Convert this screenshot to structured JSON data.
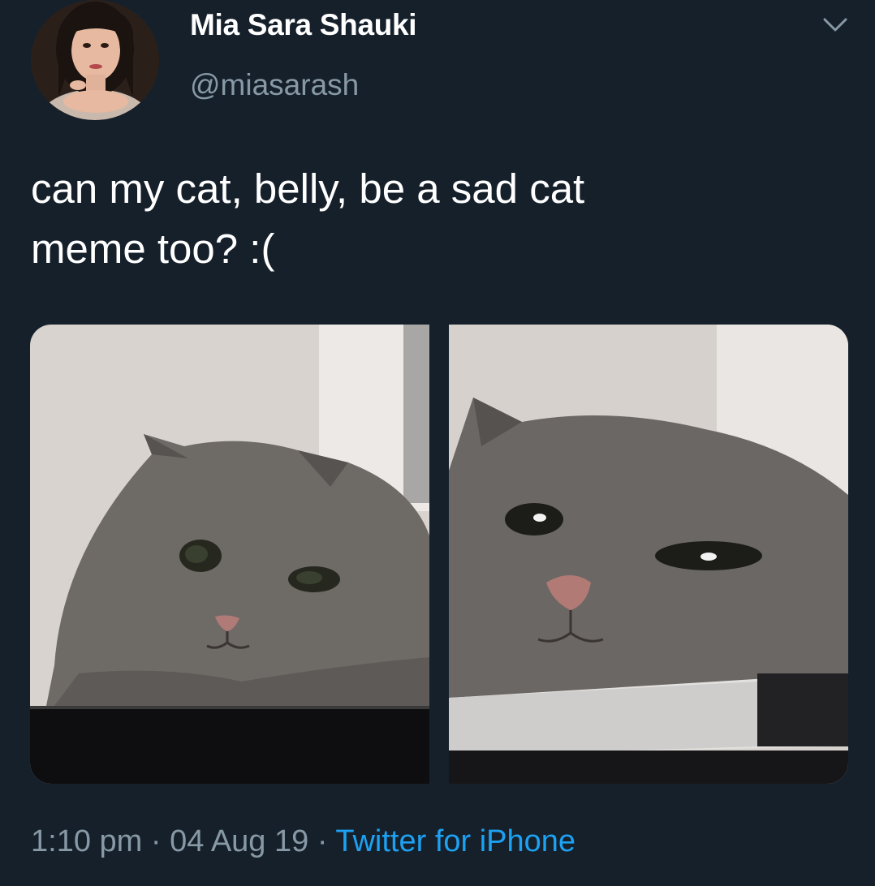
{
  "user": {
    "display_name": "Mia Sara Shauki",
    "handle": "@miasarash",
    "avatar_icon": "profile-photo"
  },
  "menu_icon": "chevron-down-icon",
  "tweet": {
    "text_line1": "can my cat, belly, be a sad cat",
    "text_line2": "meme too? :("
  },
  "media": {
    "photos": [
      {
        "icon": "sad-cat-photo-1"
      },
      {
        "icon": "sad-cat-photo-2"
      }
    ]
  },
  "meta": {
    "time": "1:10 pm",
    "separator": "·",
    "date": "04 Aug 19",
    "source": "Twitter for iPhone"
  },
  "colors": {
    "background": "#15202b",
    "secondary_text": "#8899a6",
    "link": "#1da1f2"
  }
}
